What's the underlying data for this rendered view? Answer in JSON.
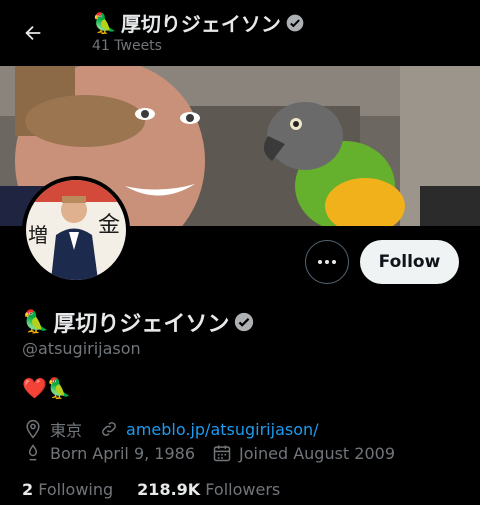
{
  "header": {
    "title": "厚切りジェイソン",
    "title_emoji": "🦜",
    "tweet_count": "41 Tweets"
  },
  "profile": {
    "display_name": "厚切りジェイソン",
    "name_emoji": "🦜",
    "handle": "@atsugirijason",
    "bio_emojis": "❤️🦜",
    "location": "東京",
    "website": "ameblo.jp/atsugirijason/",
    "born": "Born April 9, 1986",
    "joined": "Joined August 2009"
  },
  "actions": {
    "follow_label": "Follow",
    "more_label": "•••"
  },
  "stats": {
    "following_count": "2",
    "following_label": "Following",
    "followers_count": "218.9K",
    "followers_label": "Followers"
  },
  "colors": {
    "background": "#000000",
    "text_primary": "#e7e9ea",
    "text_secondary": "#71767b",
    "link": "#1d9bf0",
    "follow_bg": "#eff3f4"
  },
  "icons": [
    "back-arrow-icon",
    "verified-icon",
    "more-icon",
    "location-icon",
    "link-icon",
    "birthday-icon",
    "calendar-icon"
  ]
}
